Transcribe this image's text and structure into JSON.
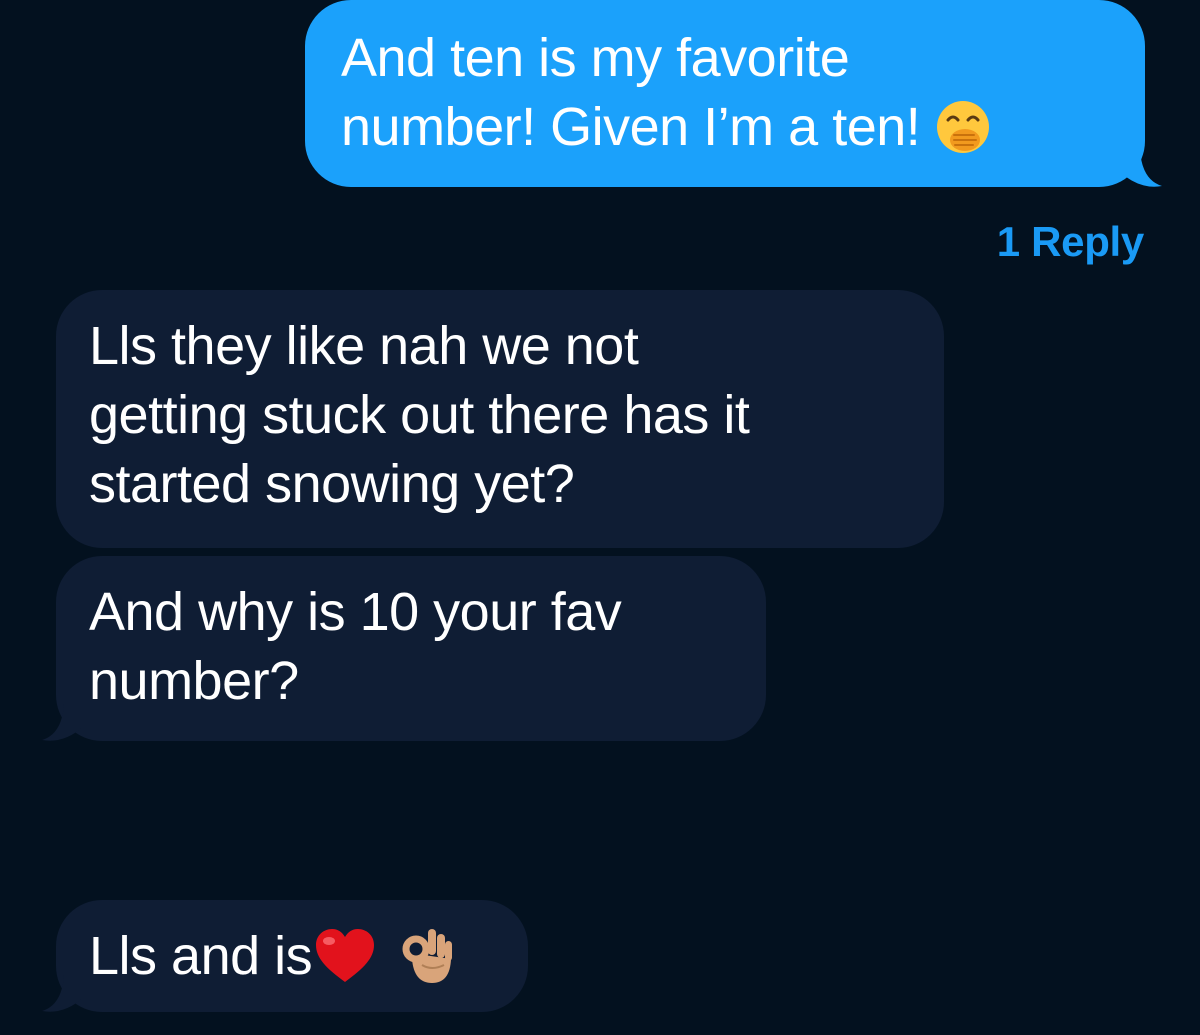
{
  "conversation": {
    "messages": [
      {
        "direction": "outgoing",
        "lines": [
          "And ten is my favorite",
          "number! Given I’m a ten!"
        ],
        "emoji": "face-with-hand-over-mouth",
        "reply_count_label": "1 Reply"
      },
      {
        "direction": "incoming",
        "lines": [
          "Lls they like nah we not",
          "getting stuck out there has it",
          "started snowing yet?"
        ]
      },
      {
        "direction": "incoming",
        "lines": [
          "And why is 10 your fav",
          "number?"
        ]
      },
      {
        "direction": "incoming",
        "lines": [
          "Lls and is"
        ],
        "emoji": [
          "red-heart",
          "ok-hand"
        ]
      }
    ]
  },
  "colors": {
    "background": "#03111f",
    "outgoing_bubble": "#1ba1fb",
    "incoming_bubble": "#0f1d34",
    "reply_link": "#1a9af5",
    "text": "#ffffff"
  }
}
